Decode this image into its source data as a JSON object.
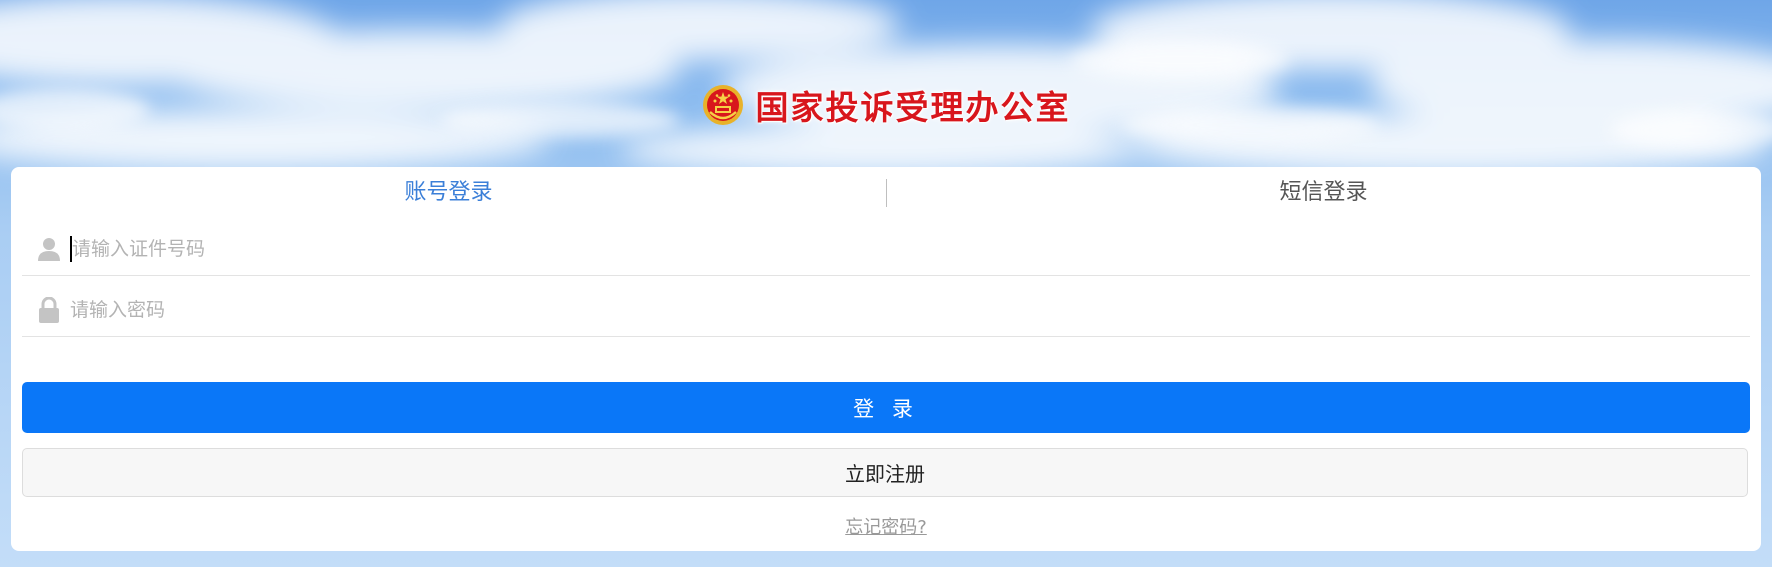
{
  "header": {
    "title": "国家投诉受理办公室",
    "emblem_icon": "national-emblem-icon",
    "title_color": "#d8161c"
  },
  "tabs": [
    {
      "label": "账号登录",
      "active": true
    },
    {
      "label": "短信登录",
      "active": false
    }
  ],
  "form": {
    "id_field": {
      "placeholder": "请输入证件号码",
      "value": "",
      "icon": "user-icon"
    },
    "password_field": {
      "placeholder": "请输入密码",
      "value": "",
      "icon": "lock-icon"
    }
  },
  "buttons": {
    "login_label": "登 录",
    "register_label": "立即注册"
  },
  "links": {
    "forgot_password": "忘记密码?"
  },
  "colors": {
    "accent": "#0a77f8",
    "active_tab": "#3b7fd8"
  }
}
